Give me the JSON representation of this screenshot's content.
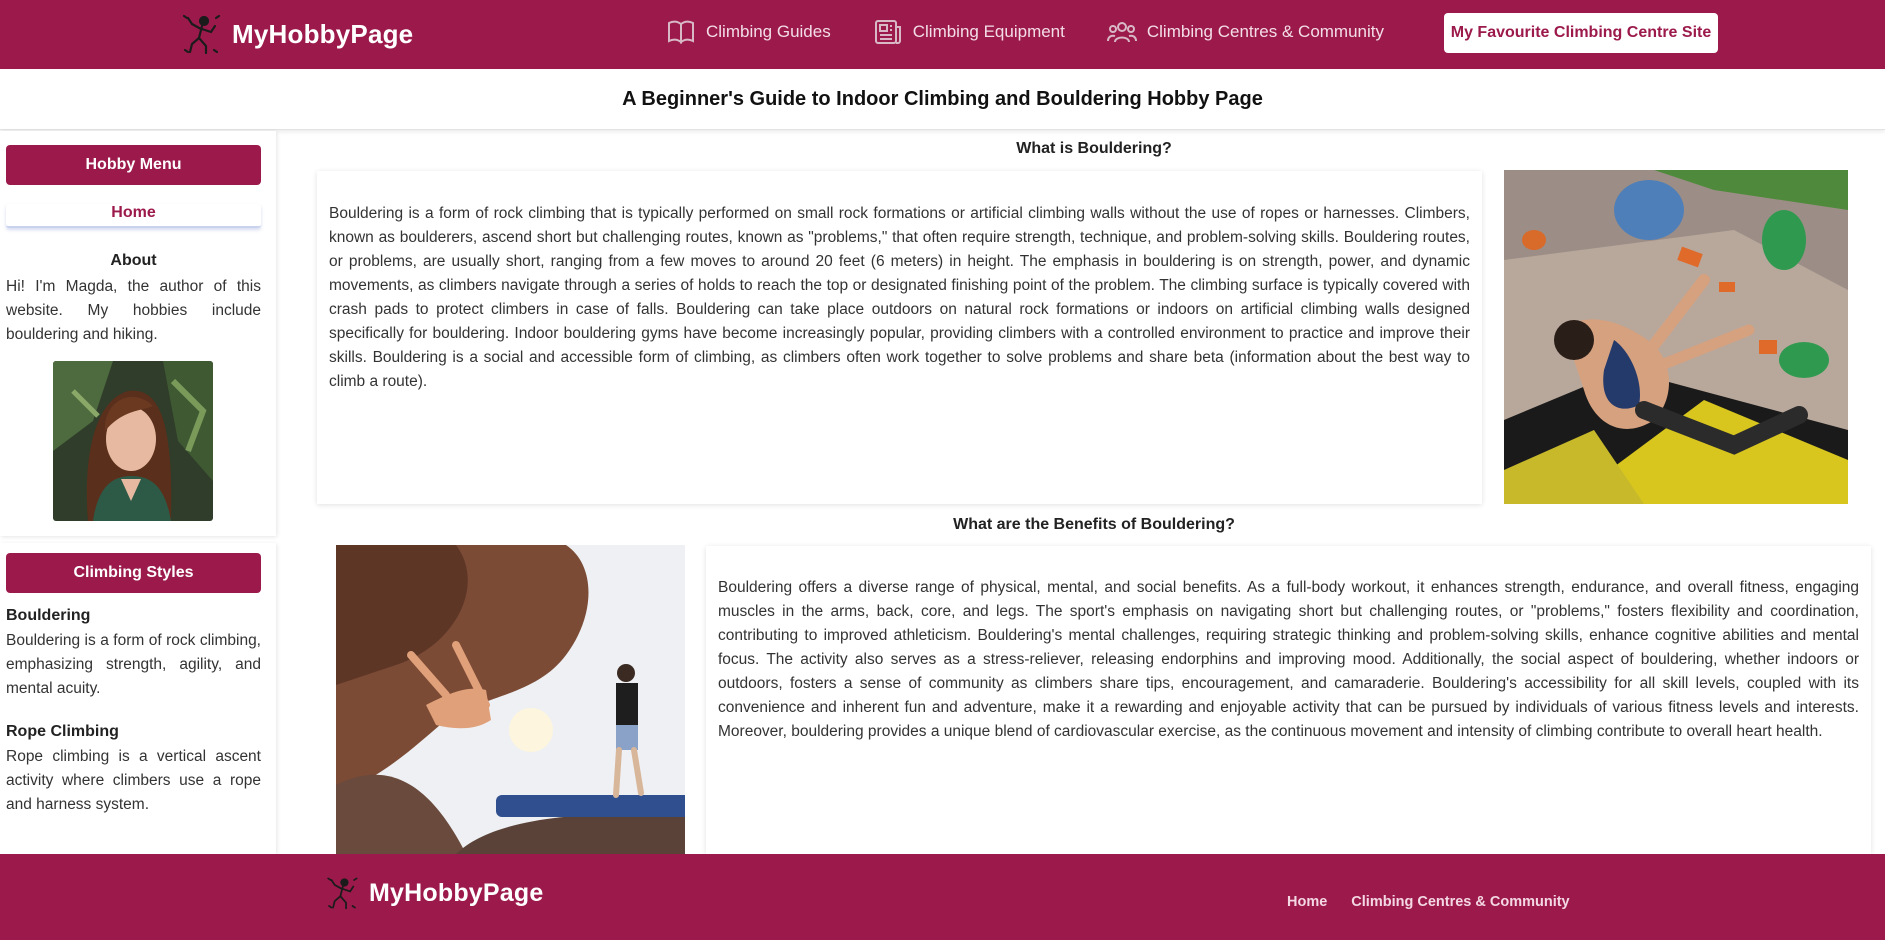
{
  "header": {
    "brand": "MyHobbyPage",
    "nav": [
      {
        "label": "Climbing Guides",
        "icon": "book-icon"
      },
      {
        "label": "Climbing Equipment",
        "icon": "newspaper-icon"
      },
      {
        "label": "Climbing Centres & Community",
        "icon": "people-icon"
      }
    ],
    "cta": "My Favourite Climbing Centre Site"
  },
  "title": "A Beginner's Guide to Indoor Climbing and Bouldering Hobby Page",
  "sidebar": {
    "menu_title": "Hobby Menu",
    "home": "Home",
    "about_title": "About",
    "about_text": "Hi! I'm Magda, the author of this website. My hobbies include bouldering and hiking.",
    "styles_title": "Climbing Styles",
    "styles": [
      {
        "name": "Bouldering",
        "text": "Bouldering is a form of rock climbing, emphasizing strength, agility, and mental acuity."
      },
      {
        "name": "Rope Climbing",
        "text": "Rope climbing is a vertical ascent activity where climbers use a rope and harness system."
      }
    ]
  },
  "main": {
    "section1": {
      "title": "What is Bouldering?",
      "text": "Bouldering is a form of rock climbing that is typically performed on small rock formations or artificial climbing walls without the use of ropes or harnesses. Climbers, known as boulderers, ascend short but challenging routes, known as \"problems,\" that often require strength, technique, and problem-solving skills. Bouldering routes, or problems, are usually short, ranging from a few moves to around 20 feet (6 meters) in height. The emphasis in bouldering is on strength, power, and dynamic movements, as climbers navigate through a series of holds to reach the top or designated finishing point of the problem. The climbing surface is typically covered with crash pads to protect climbers in case of falls. Bouldering can take place outdoors on natural rock formations or indoors on artificial climbing walls designed specifically for bouldering. Indoor bouldering gyms have become increasingly popular, providing climbers with a controlled environment to practice and improve their skills. Bouldering is a social and accessible form of climbing, as climbers often work together to solve problems and share beta (information about the best way to climb a route)."
    },
    "section2": {
      "title": "What are the Benefits of Bouldering?",
      "text": "Bouldering offers a diverse range of physical, mental, and social benefits. As a full-body workout, it enhances strength, endurance, and overall fitness, engaging muscles in the arms, back, core, and legs. The sport's emphasis on navigating short but challenging routes, or \"problems,\" fosters flexibility and coordination, contributing to improved athleticism. Bouldering's mental challenges, requiring strategic thinking and problem-solving skills, enhance cognitive abilities and mental focus. The activity also serves as a stress-reliever, releasing endorphins and improving mood. Additionally, the social aspect of bouldering, whether indoors or outdoors, fosters a sense of community as climbers share tips, encouragement, and camaraderie. Bouldering's accessibility for all skill levels, coupled with its convenience and inherent fun and adventure, make it a rewarding and enjoyable activity that can be pursued by individuals of various fitness levels and interests. Moreover, bouldering provides a unique blend of cardiovascular exercise, as the continuous movement and intensity of climbing contribute to overall heart health."
    }
  },
  "footer": {
    "brand": "MyHobbyPage",
    "links": [
      "Home",
      "Climbing Centres & Community"
    ]
  },
  "colors": {
    "brand": "#9c1a4b",
    "accent_text": "#9c1a4b",
    "background": "#ffffff"
  }
}
